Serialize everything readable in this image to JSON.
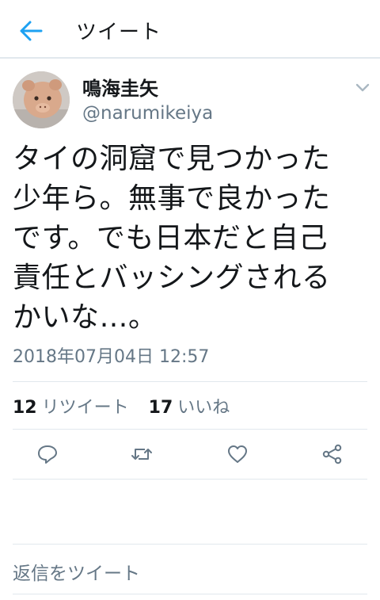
{
  "header": {
    "title": "ツイート",
    "back_icon": "arrow-left-icon"
  },
  "tweet": {
    "display_name": "鳴海圭矢",
    "handle": "@narumikeiya",
    "text_lines": [
      "タイの洞窟で見つかった",
      "少年ら。無事で良かった",
      "です。でも日本だと自己",
      "責任とバッシングされる",
      "かいな…。"
    ],
    "timestamp": "2018年07月04日 12:57"
  },
  "stats": {
    "retweets_count": "12",
    "retweets_label": "リツイート",
    "likes_count": "17",
    "likes_label": "いいね"
  },
  "actions": [
    "reply-icon",
    "retweet-icon",
    "like-icon",
    "share-icon"
  ],
  "reply": {
    "placeholder": "返信をツイート"
  },
  "colors": {
    "accent": "#1da1f2",
    "secondary_text": "#657786",
    "divider": "#e1e8ed"
  }
}
